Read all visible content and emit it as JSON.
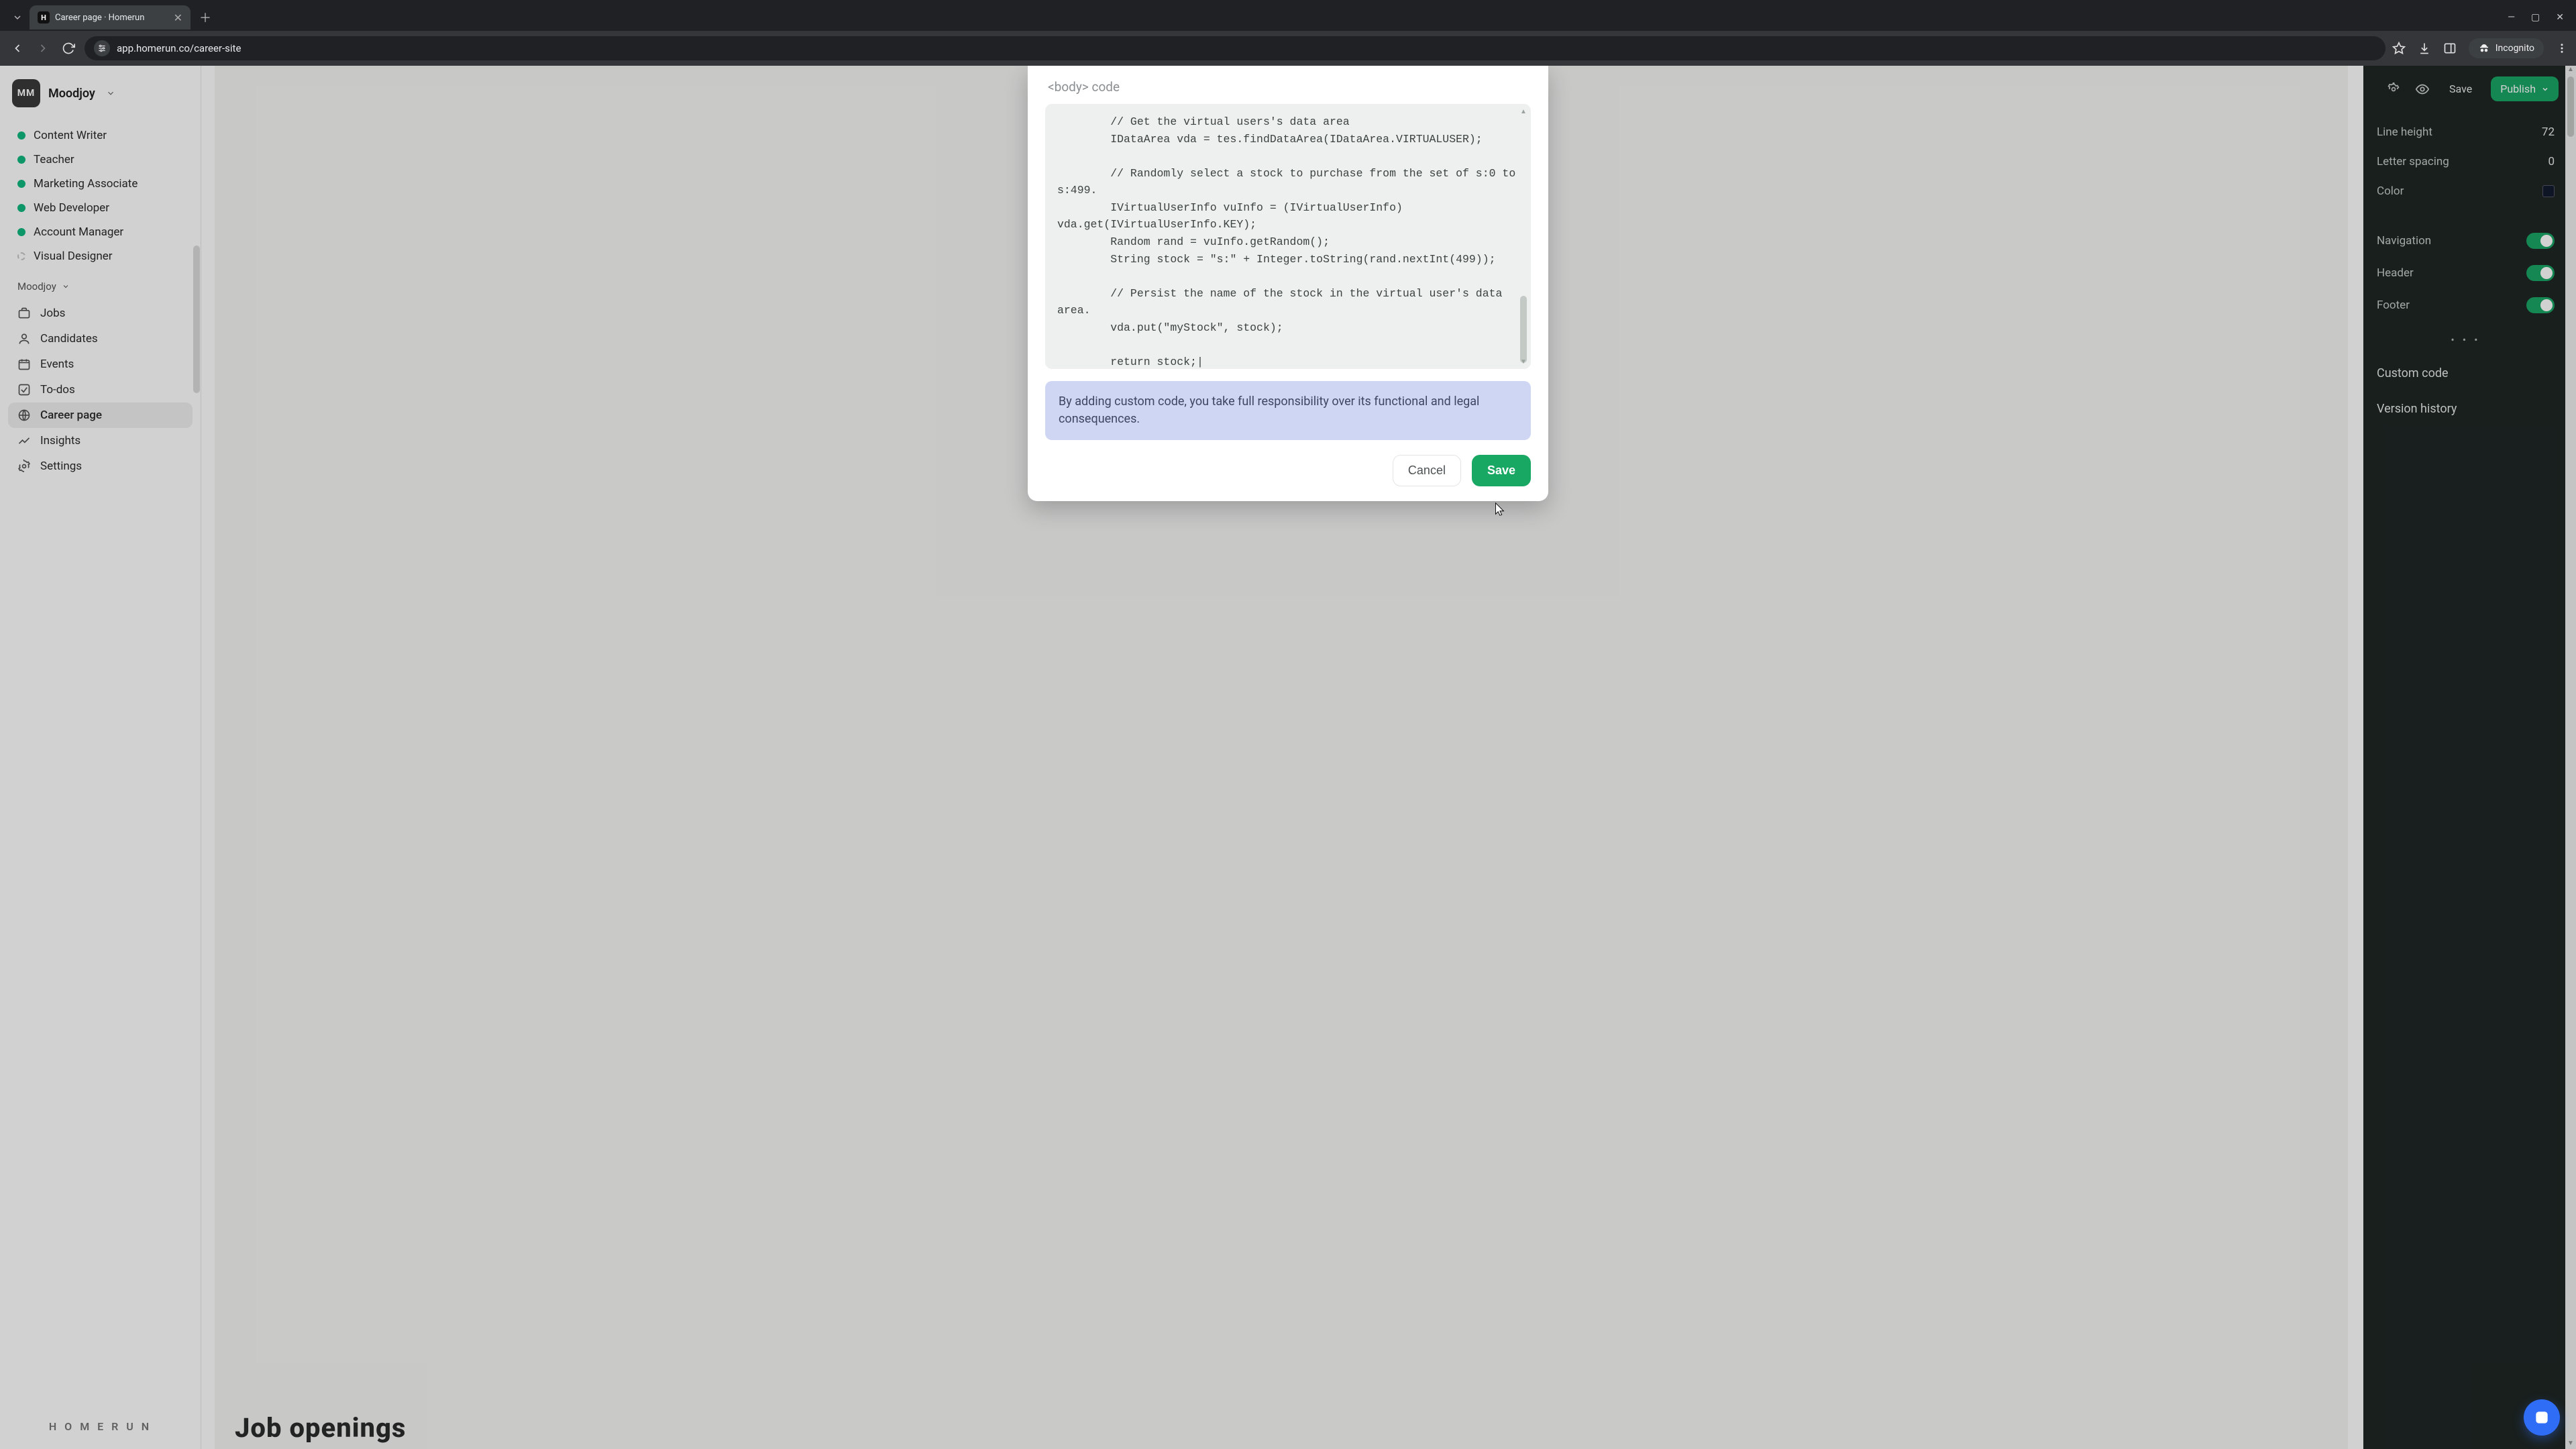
{
  "browser": {
    "tab_title": "Career page · Homerun",
    "url": "app.homerun.co/career-site",
    "incognito_label": "Incognito"
  },
  "workspace": {
    "avatar_initials": "MM",
    "name": "Moodjoy"
  },
  "jobs": [
    {
      "label": "Content Writer",
      "status": "active"
    },
    {
      "label": "Teacher",
      "status": "active"
    },
    {
      "label": "Marketing Associate",
      "status": "active"
    },
    {
      "label": "Web Developer",
      "status": "active"
    },
    {
      "label": "Account Manager",
      "status": "active"
    },
    {
      "label": "Visual Designer",
      "status": "draft"
    }
  ],
  "section_switch": "Moodjoy",
  "nav": {
    "jobs": "Jobs",
    "candidates": "Candidates",
    "events": "Events",
    "todos": "To-dos",
    "career_page": "Career page",
    "insights": "Insights",
    "settings": "Settings"
  },
  "brand": "H O M E R U N",
  "canvas": {
    "heading": "Job openings"
  },
  "right_panel": {
    "save": "Save",
    "publish": "Publish",
    "rows": {
      "line_height": {
        "label": "Line height",
        "value": "72"
      },
      "letter_spacing": {
        "label": "Letter spacing",
        "value": "0"
      },
      "color": {
        "label": "Color"
      },
      "navigation": {
        "label": "Navigation"
      },
      "header": {
        "label": "Header"
      },
      "footer": {
        "label": "Footer"
      }
    },
    "custom_code": "Custom code",
    "version_history": "Version history"
  },
  "modal": {
    "title": "<body> code",
    "code": "        // Get the virtual users's data area\n        IDataArea vda = tes.findDataArea(IDataArea.VIRTUALUSER);\n\n        // Randomly select a stock to purchase from the set of s:0 to s:499.\n        IVirtualUserInfo vuInfo = (IVirtualUserInfo) vda.get(IVirtualUserInfo.KEY);\n        Random rand = vuInfo.getRandom();\n        String stock = \"s:\" + Integer.toString(rand.nextInt(499));\n\n        // Persist the name of the stock in the virtual user's data area.\n        vda.put(\"myStock\", stock);\n\n        return stock;|",
    "notice": "By adding custom code, you take full responsibility over its functional and legal consequences.",
    "cancel": "Cancel",
    "save": "Save"
  }
}
